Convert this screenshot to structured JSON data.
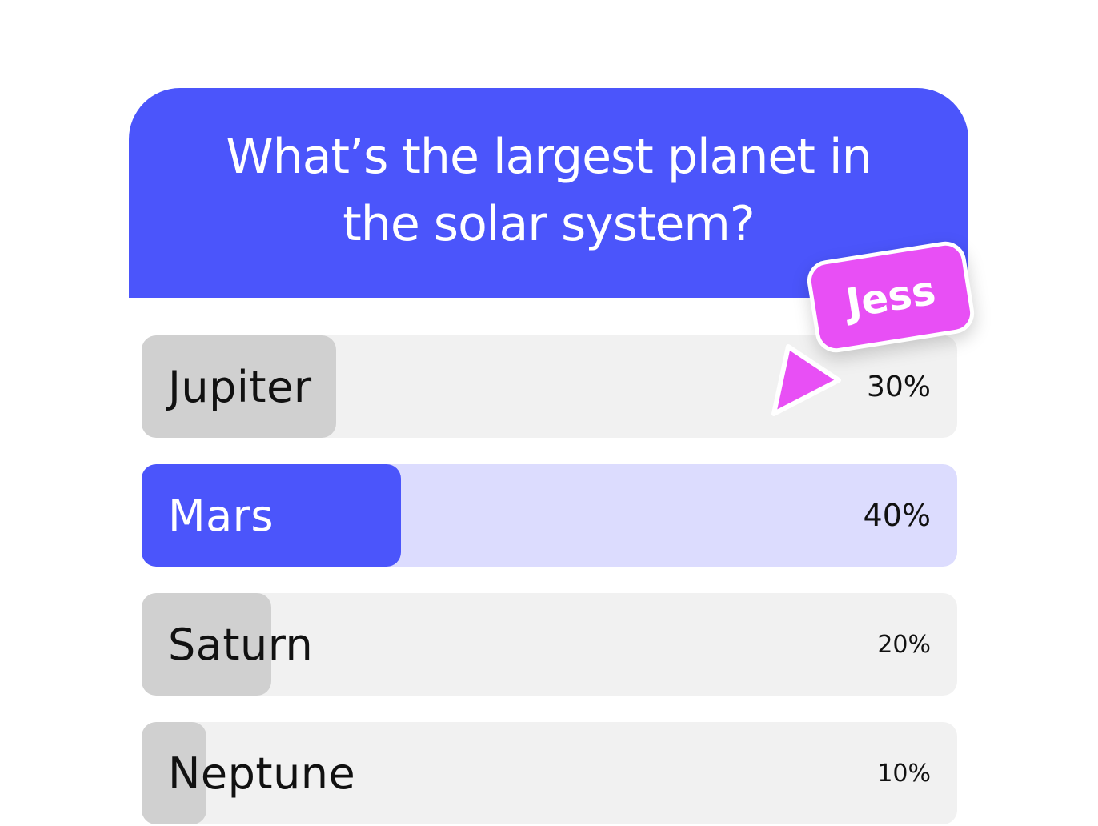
{
  "poll": {
    "question": "What’s the largest planet in the solar system?",
    "accent_color": "#4b55fb",
    "options": [
      {
        "label": "Jupiter",
        "percent_text": "30%",
        "value": 0.3,
        "selected": false
      },
      {
        "label": "Mars",
        "percent_text": "40%",
        "value": 0.4,
        "selected": true
      },
      {
        "label": "Saturn",
        "percent_text": "20%",
        "value": 0.2,
        "selected": false
      },
      {
        "label": "Neptune",
        "percent_text": "10%",
        "value": 0.1,
        "selected": false
      }
    ]
  },
  "cursor": {
    "name": "Jess",
    "color": "#e84ff5",
    "icon": "cursor-pointer-icon"
  }
}
